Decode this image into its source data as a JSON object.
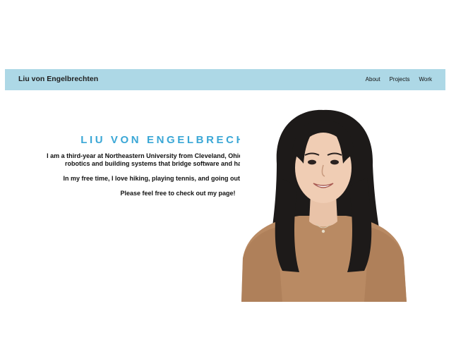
{
  "navbar": {
    "brand": "Liu von Engelbrechten",
    "links": [
      {
        "label": "About"
      },
      {
        "label": "Projects"
      },
      {
        "label": "Work"
      }
    ]
  },
  "hero": {
    "title": "LIU VON ENGELBRECHTEN",
    "paragraphs": [
      "I am a third-year at Northeastern University from Cleveland, Ohio. I'm passionate about robotics and building systems that bridge software and hardware together.",
      "In my free time, I love hiking, playing tennis, and going out to try new foods.",
      "Please feel free to check out my page!"
    ]
  },
  "colors": {
    "navbar_bg": "#add8e6",
    "title_accent": "#3aa7d6",
    "sweater": "#b98a63",
    "hair": "#1d1a19"
  }
}
